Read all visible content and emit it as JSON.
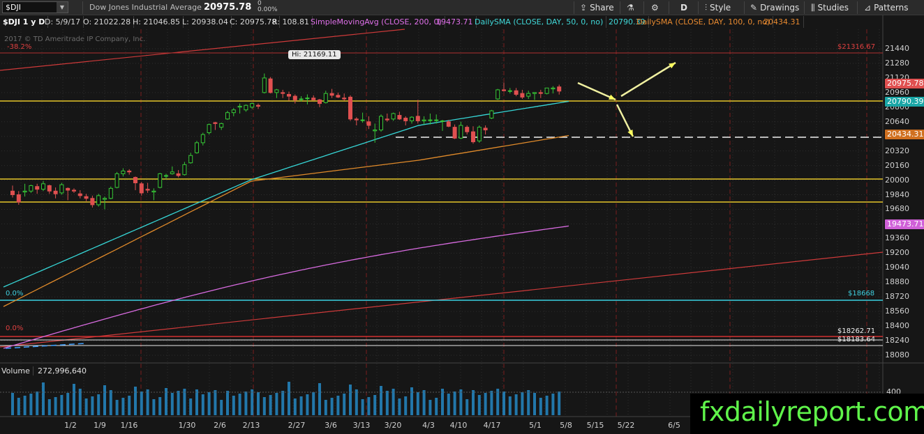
{
  "toolbar": {
    "symbol": "$DJI",
    "company": "Dow Jones Industrial Average",
    "last": "20975.78",
    "change": "0",
    "change_pct": "0.00%",
    "share": "Share",
    "period": "D",
    "style": "Style",
    "drawings": "Drawings",
    "studies": "Studies",
    "patterns": "Patterns"
  },
  "info": {
    "title": "$DJI 1 y D",
    "date": "D: 5/9/17",
    "open": "O: 21022.28",
    "high": "H: 21046.85",
    "low": "L: 20938.04",
    "close": "C: 20975.78",
    "range": "R: 108.81",
    "sma200_label": "SimpleMovingAvg (CLOSE, 200, 0)",
    "sma200_value": "19473.71",
    "sma50_label": "DailySMA (CLOSE, DAY, 50, 0, no)",
    "sma50_value": "20790.39",
    "sma100_label": "DailySMA (CLOSE, DAY, 100, 0, no)",
    "sma100_value": "20434.31"
  },
  "copyright": "2017 © TD Ameritrade IP Company, Inc.",
  "levels": {
    "fib_top": "-38.2%",
    "fib_mid": "0.0%",
    "fib_low": "0.0%",
    "price_top": "$21316.67",
    "price_mid": "$18668",
    "price_low1": "$18262.71",
    "price_low2": "$18183.64"
  },
  "hi_callout": "Hi: 21169.11",
  "volume": {
    "label": "Volume",
    "value": "272,996,640",
    "axis_label": "400"
  },
  "watermark": "fxdailyreport.com",
  "colors": {
    "up": "#37c837",
    "down": "#e05050",
    "sma50": "#36d6d6",
    "sma100": "#e08a2a",
    "sma200": "#d86be0",
    "support": "#e6c628",
    "trend": "#cf3a3a",
    "volume": "#2277aa"
  },
  "chart_data": {
    "type": "candlestick",
    "y_range": [
      18080,
      21460
    ],
    "y_ticks": [
      21440,
      21280,
      21120,
      20960,
      20800,
      20640,
      20480,
      20320,
      20160,
      20000,
      19840,
      19680,
      19520,
      19360,
      19200,
      19040,
      18880,
      18720,
      18560,
      18400,
      18240,
      18080
    ],
    "x_ticks": [
      "1/2",
      "1/9",
      "1/16",
      "1/30",
      "2/6",
      "2/13",
      "2/27",
      "3/6",
      "3/13",
      "3/20",
      "4/3",
      "4/10",
      "4/17",
      "5/1",
      "5/8",
      "5/15",
      "5/22",
      "6/5"
    ],
    "candles": [
      {
        "date": "12/29",
        "o": 19880,
        "h": 19940,
        "l": 19810,
        "c": 19840
      },
      {
        "date": "12/30",
        "o": 19840,
        "h": 19880,
        "l": 19730,
        "c": 19760
      },
      {
        "date": "1/3",
        "o": 19870,
        "h": 19960,
        "l": 19820,
        "c": 19880
      },
      {
        "date": "1/4",
        "o": 19880,
        "h": 19950,
        "l": 19860,
        "c": 19940
      },
      {
        "date": "1/5",
        "o": 19930,
        "h": 19960,
        "l": 19850,
        "c": 19900
      },
      {
        "date": "1/6",
        "o": 19900,
        "h": 19990,
        "l": 19880,
        "c": 19960
      },
      {
        "date": "1/9",
        "o": 19940,
        "h": 19950,
        "l": 19850,
        "c": 19880
      },
      {
        "date": "1/10",
        "o": 19880,
        "h": 19920,
        "l": 19800,
        "c": 19850
      },
      {
        "date": "1/11",
        "o": 19860,
        "h": 19970,
        "l": 19840,
        "c": 19950
      },
      {
        "date": "1/12",
        "o": 19910,
        "h": 19920,
        "l": 19780,
        "c": 19890
      },
      {
        "date": "1/13",
        "o": 19890,
        "h": 19910,
        "l": 19860,
        "c": 19880
      },
      {
        "date": "1/17",
        "o": 19850,
        "h": 19890,
        "l": 19800,
        "c": 19830
      },
      {
        "date": "1/18",
        "o": 19820,
        "h": 19850,
        "l": 19770,
        "c": 19800
      },
      {
        "date": "1/19",
        "o": 19800,
        "h": 19830,
        "l": 19700,
        "c": 19730
      },
      {
        "date": "1/20",
        "o": 19730,
        "h": 19850,
        "l": 19710,
        "c": 19830
      },
      {
        "date": "1/23",
        "o": 19790,
        "h": 19820,
        "l": 19680,
        "c": 19800
      },
      {
        "date": "1/24",
        "o": 19800,
        "h": 19930,
        "l": 19790,
        "c": 19910
      },
      {
        "date": "1/25",
        "o": 19920,
        "h": 20090,
        "l": 19910,
        "c": 20070
      },
      {
        "date": "1/26",
        "o": 20070,
        "h": 20130,
        "l": 20040,
        "c": 20100
      },
      {
        "date": "1/27",
        "o": 20100,
        "h": 20120,
        "l": 20060,
        "c": 20090
      },
      {
        "date": "1/30",
        "o": 20030,
        "h": 20040,
        "l": 19890,
        "c": 19970
      },
      {
        "date": "1/31",
        "o": 19960,
        "h": 19980,
        "l": 19830,
        "c": 19860
      },
      {
        "date": "2/1",
        "o": 19900,
        "h": 19970,
        "l": 19860,
        "c": 19890
      },
      {
        "date": "2/2",
        "o": 19870,
        "h": 19910,
        "l": 19780,
        "c": 19880
      },
      {
        "date": "2/3",
        "o": 19920,
        "h": 20080,
        "l": 19910,
        "c": 20070
      },
      {
        "date": "2/6",
        "o": 20050,
        "h": 20070,
        "l": 20010,
        "c": 20050
      },
      {
        "date": "2/7",
        "o": 20070,
        "h": 20150,
        "l": 20060,
        "c": 20090
      },
      {
        "date": "2/8",
        "o": 20070,
        "h": 20110,
        "l": 20030,
        "c": 20050
      },
      {
        "date": "2/9",
        "o": 20060,
        "h": 20200,
        "l": 20050,
        "c": 20170
      },
      {
        "date": "2/10",
        "o": 20190,
        "h": 20300,
        "l": 20180,
        "c": 20270
      },
      {
        "date": "2/13",
        "o": 20300,
        "h": 20430,
        "l": 20290,
        "c": 20410
      },
      {
        "date": "2/14",
        "o": 20410,
        "h": 20520,
        "l": 20380,
        "c": 20500
      },
      {
        "date": "2/15",
        "o": 20520,
        "h": 20620,
        "l": 20500,
        "c": 20610
      },
      {
        "date": "2/16",
        "o": 20630,
        "h": 20640,
        "l": 20550,
        "c": 20620
      },
      {
        "date": "2/17",
        "o": 20580,
        "h": 20630,
        "l": 20550,
        "c": 20620
      },
      {
        "date": "2/21",
        "o": 20670,
        "h": 20760,
        "l": 20660,
        "c": 20740
      },
      {
        "date": "2/22",
        "o": 20740,
        "h": 20790,
        "l": 20700,
        "c": 20770
      },
      {
        "date": "2/23",
        "o": 20800,
        "h": 20840,
        "l": 20730,
        "c": 20810
      },
      {
        "date": "2/24",
        "o": 20770,
        "h": 20830,
        "l": 20750,
        "c": 20820
      },
      {
        "date": "2/27",
        "o": 20800,
        "h": 20850,
        "l": 20780,
        "c": 20840
      },
      {
        "date": "2/28",
        "o": 20820,
        "h": 20840,
        "l": 20780,
        "c": 20810
      },
      {
        "date": "3/1",
        "o": 20960,
        "h": 21169,
        "l": 20950,
        "c": 21120
      },
      {
        "date": "3/2",
        "o": 21110,
        "h": 21130,
        "l": 20950,
        "c": 20960
      },
      {
        "date": "3/3",
        "o": 20960,
        "h": 21000,
        "l": 20900,
        "c": 20990
      },
      {
        "date": "3/6",
        "o": 20960,
        "h": 20990,
        "l": 20900,
        "c": 20950
      },
      {
        "date": "3/7",
        "o": 20940,
        "h": 20970,
        "l": 20870,
        "c": 20920
      },
      {
        "date": "3/8",
        "o": 20920,
        "h": 20940,
        "l": 20840,
        "c": 20880
      },
      {
        "date": "3/9",
        "o": 20890,
        "h": 20920,
        "l": 20860,
        "c": 20890
      },
      {
        "date": "3/10",
        "o": 20900,
        "h": 20940,
        "l": 20830,
        "c": 20900
      },
      {
        "date": "3/13",
        "o": 20900,
        "h": 20930,
        "l": 20880,
        "c": 20880
      },
      {
        "date": "3/14",
        "o": 20880,
        "h": 20890,
        "l": 20800,
        "c": 20840
      },
      {
        "date": "3/15",
        "o": 20850,
        "h": 20980,
        "l": 20840,
        "c": 20950
      },
      {
        "date": "3/16",
        "o": 20950,
        "h": 21000,
        "l": 20900,
        "c": 20930
      },
      {
        "date": "3/17",
        "o": 20930,
        "h": 20960,
        "l": 20900,
        "c": 20910
      },
      {
        "date": "3/20",
        "o": 20900,
        "h": 20950,
        "l": 20870,
        "c": 20890
      },
      {
        "date": "3/21",
        "o": 20910,
        "h": 20930,
        "l": 20650,
        "c": 20670
      },
      {
        "date": "3/22",
        "o": 20670,
        "h": 20690,
        "l": 20600,
        "c": 20660
      },
      {
        "date": "3/23",
        "o": 20660,
        "h": 20740,
        "l": 20630,
        "c": 20660
      },
      {
        "date": "3/24",
        "o": 20640,
        "h": 20700,
        "l": 20560,
        "c": 20600
      },
      {
        "date": "3/27",
        "o": 20540,
        "h": 20620,
        "l": 20410,
        "c": 20550
      },
      {
        "date": "3/28",
        "o": 20550,
        "h": 20720,
        "l": 20530,
        "c": 20700
      },
      {
        "date": "3/29",
        "o": 20670,
        "h": 20730,
        "l": 20640,
        "c": 20660
      },
      {
        "date": "3/30",
        "o": 20670,
        "h": 20740,
        "l": 20650,
        "c": 20730
      },
      {
        "date": "3/31",
        "o": 20710,
        "h": 20750,
        "l": 20660,
        "c": 20670
      },
      {
        "date": "4/3",
        "o": 20680,
        "h": 20700,
        "l": 20600,
        "c": 20650
      },
      {
        "date": "4/4",
        "o": 20650,
        "h": 20700,
        "l": 20620,
        "c": 20690
      },
      {
        "date": "4/5",
        "o": 20700,
        "h": 20880,
        "l": 20620,
        "c": 20650
      },
      {
        "date": "4/6",
        "o": 20650,
        "h": 20700,
        "l": 20610,
        "c": 20660
      },
      {
        "date": "4/7",
        "o": 20660,
        "h": 20730,
        "l": 20610,
        "c": 20660
      },
      {
        "date": "4/10",
        "o": 20660,
        "h": 20720,
        "l": 20620,
        "c": 20660
      },
      {
        "date": "4/11",
        "o": 20650,
        "h": 20660,
        "l": 20540,
        "c": 20650
      },
      {
        "date": "4/12",
        "o": 20640,
        "h": 20660,
        "l": 20580,
        "c": 20590
      },
      {
        "date": "4/13",
        "o": 20580,
        "h": 20610,
        "l": 20450,
        "c": 20460
      },
      {
        "date": "4/17",
        "o": 20460,
        "h": 20640,
        "l": 20450,
        "c": 20600
      },
      {
        "date": "4/18",
        "o": 20580,
        "h": 20600,
        "l": 20500,
        "c": 20530
      },
      {
        "date": "4/19",
        "o": 20530,
        "h": 20590,
        "l": 20400,
        "c": 20420
      },
      {
        "date": "4/20",
        "o": 20430,
        "h": 20600,
        "l": 20410,
        "c": 20580
      },
      {
        "date": "4/21",
        "o": 20570,
        "h": 20600,
        "l": 20500,
        "c": 20550
      },
      {
        "date": "4/24",
        "o": 20680,
        "h": 20770,
        "l": 20670,
        "c": 20760
      },
      {
        "date": "4/25",
        "o": 20890,
        "h": 21000,
        "l": 20880,
        "c": 20990
      },
      {
        "date": "4/26",
        "o": 20990,
        "h": 21070,
        "l": 20970,
        "c": 20980
      },
      {
        "date": "4/27",
        "o": 20980,
        "h": 21010,
        "l": 20950,
        "c": 20980
      },
      {
        "date": "4/28",
        "o": 20980,
        "h": 21010,
        "l": 20920,
        "c": 20940
      },
      {
        "date": "5/1",
        "o": 20950,
        "h": 20990,
        "l": 20890,
        "c": 20910
      },
      {
        "date": "5/2",
        "o": 20920,
        "h": 20980,
        "l": 20890,
        "c": 20950
      },
      {
        "date": "5/3",
        "o": 20950,
        "h": 20960,
        "l": 20880,
        "c": 20960
      },
      {
        "date": "5/4",
        "o": 20960,
        "h": 20990,
        "l": 20900,
        "c": 20950
      },
      {
        "date": "5/5",
        "o": 20950,
        "h": 21010,
        "l": 20940,
        "c": 21010
      },
      {
        "date": "5/8",
        "o": 21000,
        "h": 21030,
        "l": 20950,
        "c": 21010
      },
      {
        "date": "5/9",
        "o": 21022.28,
        "h": 21046.85,
        "l": 20938.04,
        "c": 20975.78
      }
    ],
    "sma50_end": 20790.39,
    "sma100_end": 20434.31,
    "sma200_end": 19473.71
  }
}
